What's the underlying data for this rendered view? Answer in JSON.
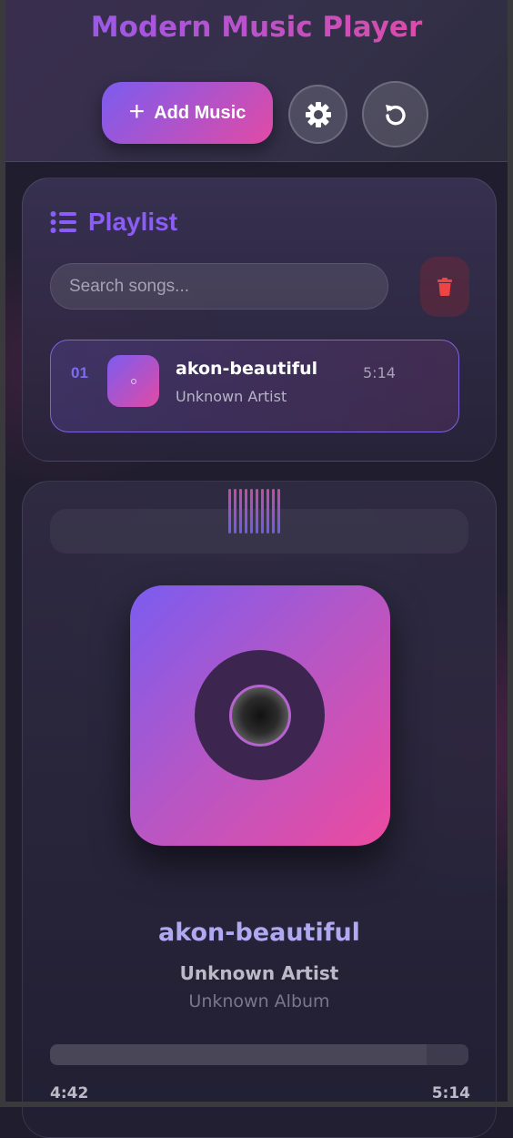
{
  "header": {
    "title": "Modern Music Player",
    "add_music_label": "Add Music",
    "add_icon": "plus-icon",
    "settings_icon": "gear-icon",
    "reset_icon": "refresh-icon"
  },
  "playlist": {
    "title": "Playlist",
    "title_icon": "list-icon",
    "search": {
      "placeholder": "Search songs...",
      "value": ""
    },
    "clear_icon": "trash-icon",
    "songs": [
      {
        "number": "01",
        "title": "akon-beautiful",
        "artist": "Unknown Artist",
        "duration": "5:14",
        "active": true
      }
    ]
  },
  "player": {
    "title": "akon-beautiful",
    "artist": "Unknown Artist",
    "album": "Unknown Album",
    "current_time": "4:42",
    "total_time": "5:14",
    "progress_fraction": 0.9
  },
  "colors": {
    "accent_purple": "#8b5cf6",
    "accent_pink": "#ec4899",
    "background": "#1f1d2e",
    "danger": "#ef4444"
  }
}
